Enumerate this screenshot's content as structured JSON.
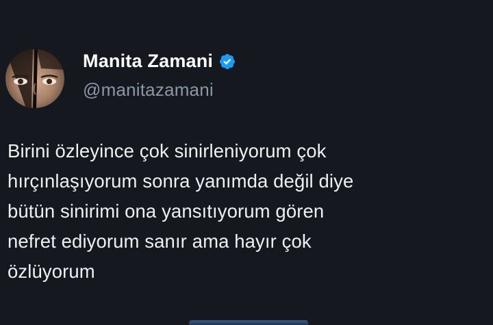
{
  "author": {
    "display_name": "Manita Zamani",
    "handle": "@manitazamani",
    "verified_icon": "verified-badge-icon",
    "verified_color": "#1d9bf0"
  },
  "tweet": {
    "lines": [
      "Birini özleyince çok sinirleniyorum çok",
      "hırçınlaşıyorum sonra yanımda değil diye",
      "bütün sinirimi ona yansıtıyorum gören",
      "nefret ediyorum sanır ama hayır çok",
      "özlüyorum"
    ]
  },
  "colors": {
    "background": "#15181f",
    "name": "#ffffff",
    "handle": "#8b98a5",
    "text": "#eef0f2"
  }
}
